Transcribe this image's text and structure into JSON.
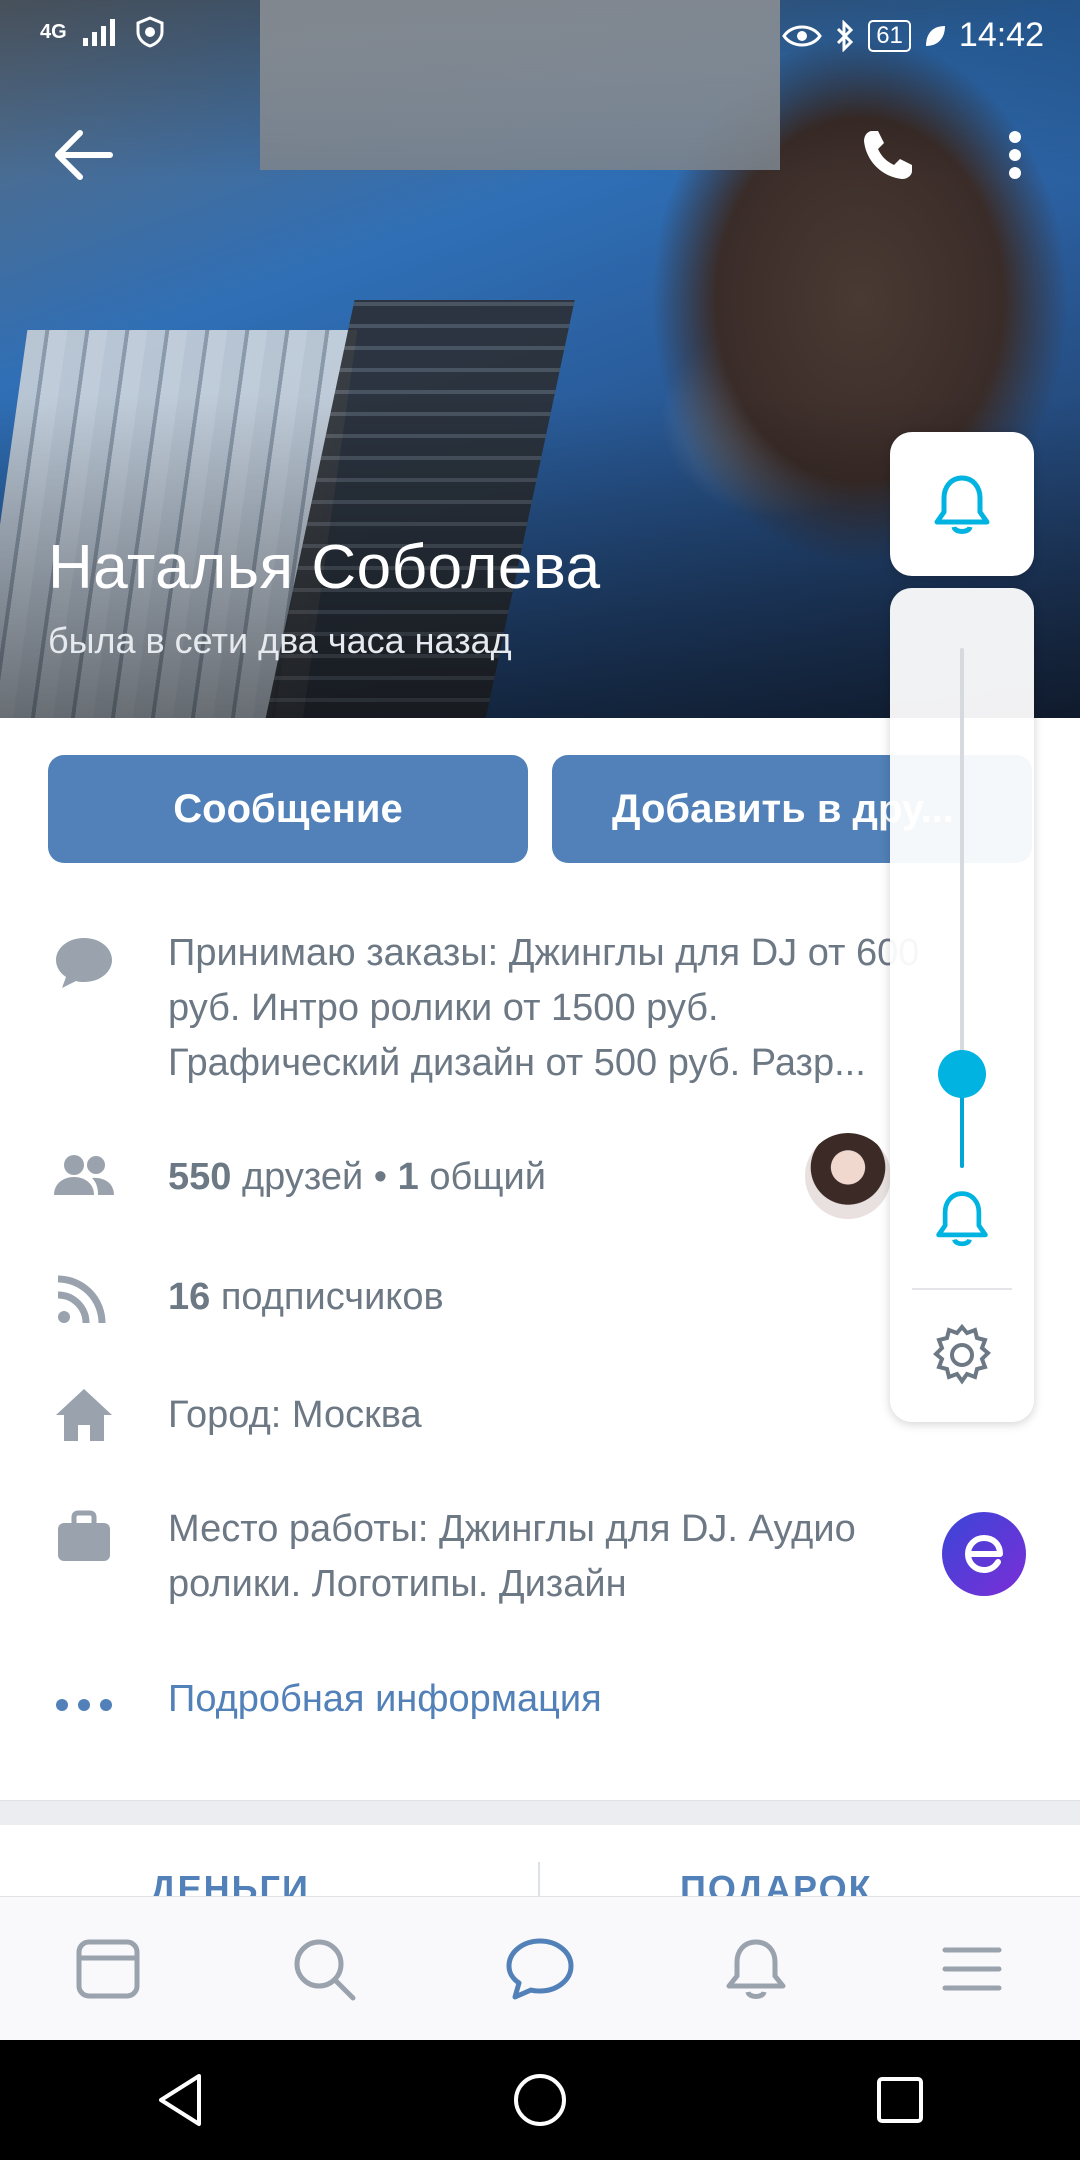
{
  "status_bar": {
    "network": "4G",
    "time": "14:42",
    "battery": "61"
  },
  "profile": {
    "name": "Наталья Соболева",
    "last_seen": "была в сети два часа назад"
  },
  "actions": {
    "message_label": "Сообщение",
    "add_friend_label": "Добавить в дру..."
  },
  "info": {
    "description": "Принимаю заказы: Джинглы для DJ от 600 руб. Интро ролики от 1500 руб. Графический дизайн от 500 руб. Разр...",
    "friends_count": "550",
    "friends_label": "друзей",
    "mutual_count": "1",
    "mutual_label": "общий",
    "followers_count": "16",
    "followers_label": "подписчиков",
    "city": "Город: Москва",
    "work": "Место работы: Джинглы для DJ. Аудио ролики. Логотипы. Дизайн",
    "more_info": "Подробная информация"
  },
  "tabs": {
    "money": "ДЕНЬГИ",
    "gift": "ПОДАРОК"
  },
  "volume_overlay": {
    "level": 0.18,
    "accent_color": "#00b3e0"
  },
  "bottom_nav": [
    "news-icon",
    "search-icon",
    "messages-icon",
    "notifications-icon",
    "menu-icon"
  ],
  "colors": {
    "brand_blue": "#5181b8",
    "text_gray": "#6d7885"
  }
}
